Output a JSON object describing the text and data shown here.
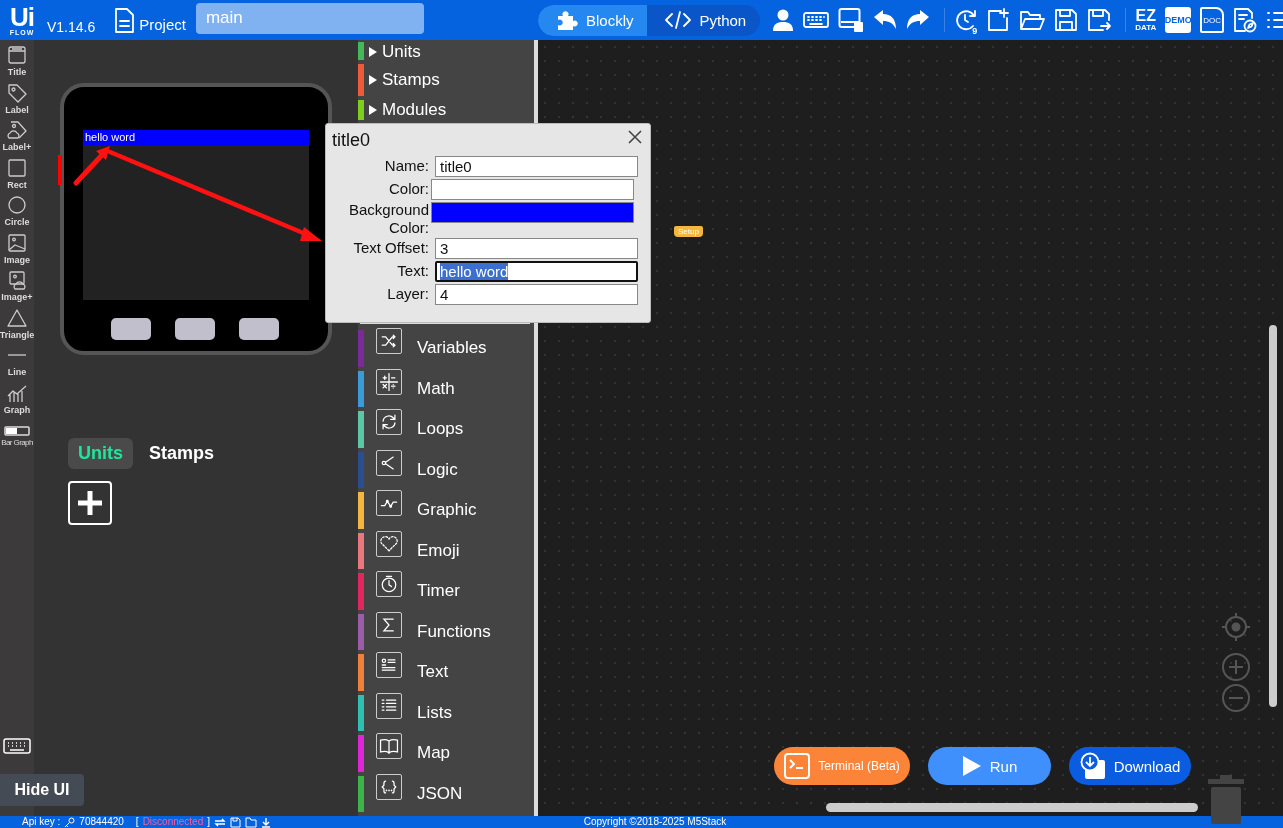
{
  "top_bar": {
    "logo": {
      "mark": "Ui",
      "word": "FLOW"
    },
    "version": "V1.14.6",
    "project_label": "Project",
    "file_name": "main",
    "mode_tabs": [
      {
        "label": "Blockly",
        "selected": true
      },
      {
        "label": "Python",
        "selected": false
      }
    ],
    "history_count": "9",
    "ez_data": {
      "top": "EZ",
      "bottom": "DATA"
    },
    "demo": "DEMO",
    "doc": "DOC"
  },
  "tools": [
    {
      "label": "Title"
    },
    {
      "label": "Label"
    },
    {
      "label": "Label+"
    },
    {
      "label": "Rect"
    },
    {
      "label": "Circle"
    },
    {
      "label": "Image"
    },
    {
      "label": "Image+"
    },
    {
      "label": "Triangle"
    },
    {
      "label": "Line"
    },
    {
      "label": "Graph"
    },
    {
      "label": "Bar Graph"
    }
  ],
  "hide_ui": "Hide UI",
  "device": {
    "screen_text": "hello word"
  },
  "panel_tabs": [
    {
      "label": "Units",
      "selected": true
    },
    {
      "label": "Stamps",
      "selected": false
    }
  ],
  "categories": [
    {
      "label": "Units",
      "kind": "folder",
      "color": "#43b95a"
    },
    {
      "label": "Stamps",
      "kind": "folder",
      "color": "#ee5a3a"
    },
    {
      "label": "Modules",
      "kind": "folder",
      "color": "#7ccf1c"
    },
    {
      "label": "Variables",
      "kind": "block",
      "color": "#7b2a9a"
    },
    {
      "label": "Math",
      "kind": "block",
      "color": "#3a9bd8"
    },
    {
      "label": "Loops",
      "kind": "block",
      "color": "#5cc7a4"
    },
    {
      "label": "Logic",
      "kind": "block",
      "color": "#2b4f8e"
    },
    {
      "label": "Graphic",
      "kind": "block",
      "color": "#f4b63f"
    },
    {
      "label": "Emoji",
      "kind": "block",
      "color": "#e9787c"
    },
    {
      "label": "Timer",
      "kind": "block",
      "color": "#e2275e"
    },
    {
      "label": "Functions",
      "kind": "block",
      "color": "#9c5da8"
    },
    {
      "label": "Text",
      "kind": "block",
      "color": "#f07f3c"
    },
    {
      "label": "Lists",
      "kind": "block",
      "color": "#2fc0b2"
    },
    {
      "label": "Map",
      "kind": "block",
      "color": "#e024d8"
    },
    {
      "label": "JSON",
      "kind": "block",
      "color": "#3cb448"
    }
  ],
  "dialog": {
    "title": "title0",
    "fields": [
      {
        "label": "Name:",
        "kind": "text",
        "value": "title0",
        "focused": false
      },
      {
        "label": "Color:",
        "kind": "color",
        "color": "#ffffff",
        "focused": false
      },
      {
        "label": "Background Color:",
        "kind": "color",
        "color": "#0000ff",
        "focused": false
      },
      {
        "label": "Text Offset:",
        "kind": "text",
        "value": "3",
        "focused": false
      },
      {
        "label": "Text:",
        "kind": "text",
        "value": "hello word",
        "focused": true
      },
      {
        "label": "Layer:",
        "kind": "text",
        "value": "4",
        "focused": false
      }
    ]
  },
  "canvas": {
    "setup_block": "Setup"
  },
  "actions": [
    {
      "label": "Terminal (Beta)",
      "kind": "terminal"
    },
    {
      "label": "Run",
      "kind": "run"
    },
    {
      "label": "Download",
      "kind": "download"
    }
  ],
  "status_bar": {
    "api_label": "Api key :",
    "api_key": "70844420",
    "bracket_open": "[",
    "connection": "Disconnected",
    "bracket_close": "]",
    "copyright": "Copyright ©2018-2025 M5Stack"
  }
}
